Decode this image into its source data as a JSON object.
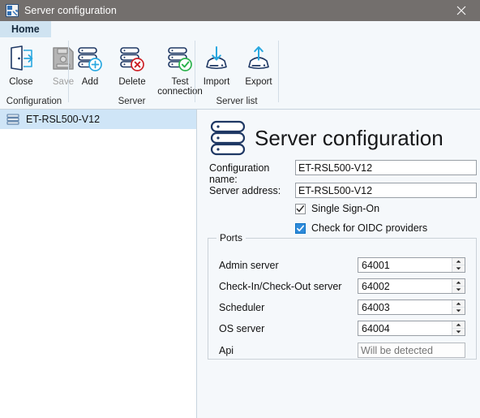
{
  "window": {
    "title": "Server configuration",
    "app_icon": "server-config-app-icon",
    "close_label": "✕"
  },
  "ribbon": {
    "tabs": [
      {
        "label": "Home",
        "active": true
      }
    ],
    "groups": [
      {
        "label": "Configuration",
        "buttons": [
          {
            "label": "Close",
            "icon": "exit-door-icon",
            "disabled": false
          },
          {
            "label": "Save",
            "icon": "floppy-disk-icon",
            "disabled": true
          }
        ]
      },
      {
        "label": "Server",
        "buttons": [
          {
            "label": "Add",
            "icon": "server-add-icon",
            "disabled": false
          },
          {
            "label": "Delete",
            "icon": "server-delete-icon",
            "disabled": false
          },
          {
            "label": "Test\nconnection",
            "label_line1": "Test",
            "label_line2": "connection",
            "icon": "server-test-icon",
            "disabled": false
          }
        ]
      },
      {
        "label": "Server list",
        "buttons": [
          {
            "label": "Import",
            "icon": "import-drive-icon",
            "disabled": false
          },
          {
            "label": "Export",
            "icon": "export-drive-icon",
            "disabled": false
          }
        ]
      }
    ]
  },
  "sidebar": {
    "items": [
      {
        "label": "ET-RSL500-V12",
        "icon": "server-icon",
        "selected": true
      }
    ]
  },
  "page": {
    "icon": "server-stack-icon",
    "title": "Server configuration",
    "fields": {
      "configuration_name": {
        "label": "Configuration name:",
        "value": "ET-RSL500-V12",
        "placeholder": ""
      },
      "server_address": {
        "label": "Server address:",
        "value": "ET-RSL500-V12",
        "placeholder": ""
      }
    },
    "checkboxes": [
      {
        "label": "Single Sign-On",
        "checked": true,
        "style": "plain"
      },
      {
        "label": "Check for OIDC providers",
        "checked": true,
        "style": "filled"
      }
    ],
    "ports": {
      "title": "Ports",
      "rows": [
        {
          "label": "Admin server",
          "value": "64001",
          "type": "spinner",
          "placeholder": ""
        },
        {
          "label": "Check-In/Check-Out server",
          "value": "64002",
          "type": "spinner",
          "placeholder": ""
        },
        {
          "label": "Scheduler",
          "value": "64003",
          "type": "spinner",
          "placeholder": ""
        },
        {
          "label": "OS server",
          "value": "64004",
          "type": "spinner",
          "placeholder": ""
        },
        {
          "label": "Api",
          "value": "",
          "type": "text-readonly",
          "placeholder": "Will be detected"
        }
      ]
    }
  },
  "colors": {
    "titlebar": "#736f6d",
    "tab_active": "#cfe3f1",
    "ribbon_bg": "#f4f8fb",
    "content_bg": "#f5f8fb",
    "selection": "#cfe5f7",
    "accent_blue": "#2e8ada",
    "icon_navy": "#1f3864",
    "icon_cyan": "#29a8e0",
    "icon_red": "#cc2026",
    "icon_green": "#2bb24c"
  }
}
